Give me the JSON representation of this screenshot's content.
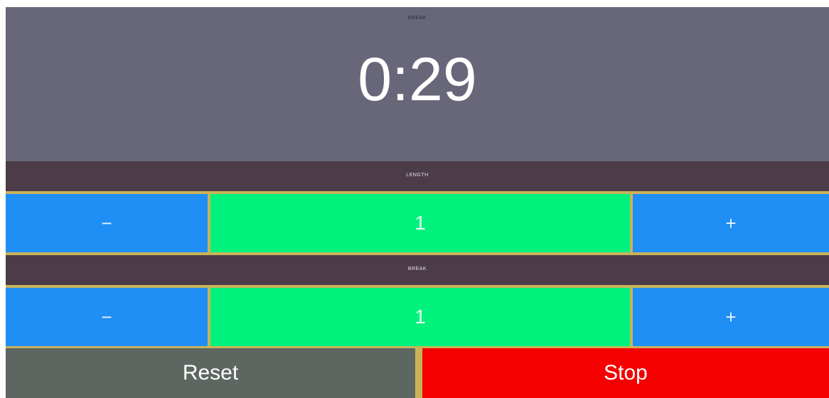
{
  "timer": {
    "label": "BREAK",
    "value": "0:29"
  },
  "length": {
    "label": "LENGTH",
    "decrement": "−",
    "value": "1",
    "increment": "+"
  },
  "break_section": {
    "label": "BREAK",
    "decrement": "−",
    "value": "1",
    "increment": "+"
  },
  "actions": {
    "reset": "Reset",
    "stop": "Stop"
  },
  "colors": {
    "timer_background": "#686779",
    "section_bar": "#4b3c48",
    "stepper_button": "#1f8ef5",
    "stepper_value": "#00f27c",
    "reset_button": "#5d6660",
    "stop_button": "#f40000",
    "divider": "#c9b35a"
  }
}
